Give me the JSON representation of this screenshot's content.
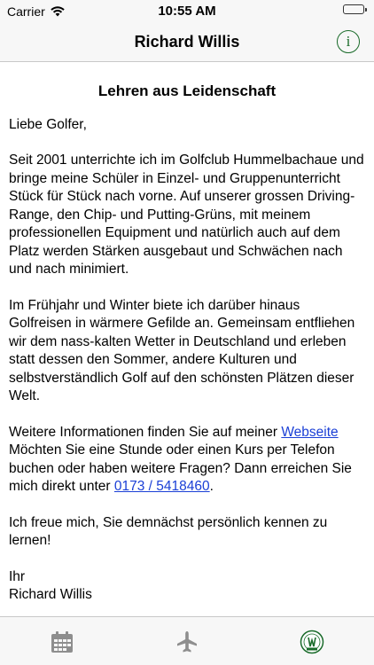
{
  "status_bar": {
    "carrier": "Carrier",
    "time": "10:55 AM",
    "battery_level": 1.0,
    "wifi_icon": "wifi-icon",
    "battery_icon": "battery-icon"
  },
  "nav": {
    "title": "Richard Willis",
    "info_icon": "info-icon",
    "info_glyph": "i",
    "accent_color": "#1a6b2a"
  },
  "article": {
    "headline": "Lehren aus Leidenschaft",
    "greeting": "Liebe Golfer,",
    "paragraph1": "Seit 2001 unterrichte ich im Golfclub Hummelbachaue und bringe meine Schüler in Einzel- und Gruppenunterricht Stück für Stück nach vorne. Auf unserer grossen Driving-Range, den Chip- und Putting-Grüns, mit meinem professionellen Equipment und natürlich auch auf dem Platz werden Stärken ausgebaut und Schwächen nach und nach minimiert.",
    "paragraph2": "Im Frühjahr und Winter biete ich darüber hinaus Golfreisen in wärmere Gefilde an. Gemeinsam entfliehen wir dem nass-kalten Wetter in Deutschland und erleben statt dessen den Sommer, andere Kulturen und selbstverständlich Golf auf den schönsten Plätzen dieser Welt.",
    "info_text_before_link": "Weitere Informationen finden Sie auf meiner ",
    "website_link": "Webseite",
    "info_text_after_link": " Möchten Sie eine Stunde oder einen Kurs per Telefon buchen oder haben weitere Fragen? Dann erreichen Sie mich direkt unter ",
    "phone_link": "0173 / 5418460",
    "info_text_end": ".",
    "closing": "Ich freue mich, Sie demnächst persönlich kennen zu lernen!",
    "signoff": "Ihr",
    "signature": "Richard Willis",
    "link_color": "#1a3fd6"
  },
  "tab_bar": {
    "tabs": [
      {
        "icon": "calendar-icon"
      },
      {
        "icon": "airplane-icon"
      },
      {
        "icon": "golf-club-logo-icon"
      }
    ]
  }
}
